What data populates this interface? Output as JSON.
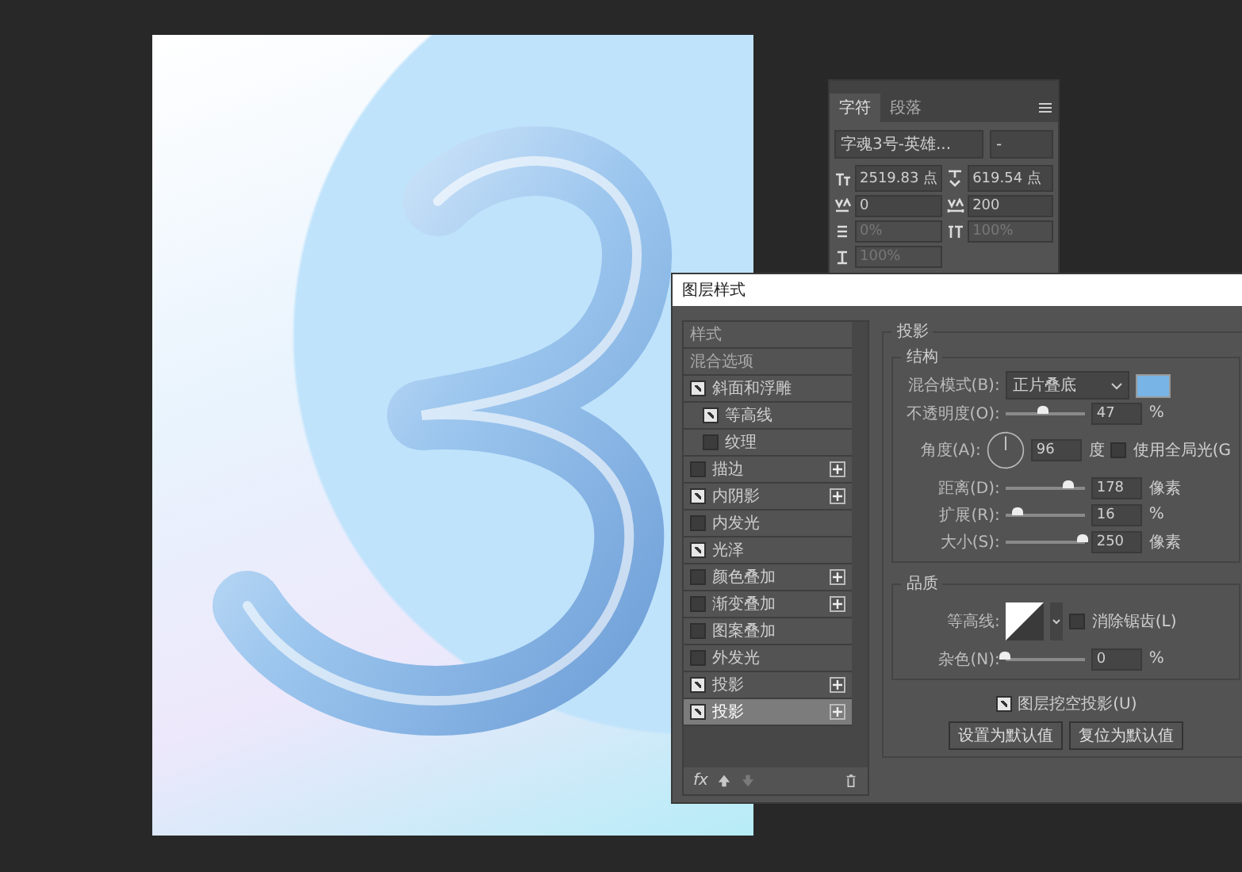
{
  "character_panel": {
    "tabs": [
      {
        "label": "字符",
        "selected": true
      },
      {
        "label": "段落",
        "selected": false
      }
    ],
    "font_family": "字魂3号-英雄...",
    "font_style": "-",
    "fields": [
      {
        "kind": "size",
        "value": "2519.83 点",
        "disabled": false
      },
      {
        "kind": "leading",
        "value": "619.54 点",
        "disabled": false
      },
      {
        "kind": "kerning",
        "value": "0",
        "disabled": false
      },
      {
        "kind": "tracking",
        "value": "200",
        "disabled": false
      },
      {
        "kind": "proportional",
        "value": "0%",
        "disabled": true
      },
      {
        "kind": "vertical_scale",
        "value": "100%",
        "disabled": true
      },
      {
        "kind": "horizontal_scale",
        "value": "100%",
        "disabled": true
      }
    ]
  },
  "layer_style": {
    "title": "图层样式",
    "styles_header": "样式",
    "blending_options": "混合选项",
    "effects": [
      {
        "label": "斜面和浮雕",
        "checked": true,
        "add_button": false,
        "selected": false,
        "children": [
          {
            "label": "等高线",
            "checked": true,
            "selected": false
          },
          {
            "label": "纹理",
            "checked": false,
            "selected": false
          }
        ]
      },
      {
        "label": "描边",
        "checked": false,
        "add_button": true,
        "selected": false
      },
      {
        "label": "内阴影",
        "checked": true,
        "add_button": true,
        "selected": false
      },
      {
        "label": "内发光",
        "checked": false,
        "add_button": false,
        "selected": false
      },
      {
        "label": "光泽",
        "checked": true,
        "add_button": false,
        "selected": false
      },
      {
        "label": "颜色叠加",
        "checked": false,
        "add_button": true,
        "selected": false
      },
      {
        "label": "渐变叠加",
        "checked": false,
        "add_button": true,
        "selected": false
      },
      {
        "label": "图案叠加",
        "checked": false,
        "add_button": false,
        "selected": false
      },
      {
        "label": "外发光",
        "checked": false,
        "add_button": false,
        "selected": false
      },
      {
        "label": "投影",
        "checked": true,
        "add_button": true,
        "selected": false
      },
      {
        "label": "投影",
        "checked": true,
        "add_button": true,
        "selected": true
      }
    ],
    "drop_shadow": {
      "title": "投影",
      "structure": {
        "title": "结构",
        "blend_mode_label": "混合模式(B):",
        "blend_mode": "正片叠底",
        "color": "#78b4e6",
        "rows": [
          {
            "kind": "slider",
            "label": "不透明度(O):",
            "level": 0.47,
            "value": "47",
            "unit": "%"
          },
          {
            "kind": "angle",
            "label": "角度(A):",
            "value": "96",
            "unit": "度",
            "checkbox_label": "使用全局光(G",
            "checked": false
          },
          {
            "kind": "slider",
            "label": "距离(D):",
            "level": 0.8,
            "value": "178",
            "unit": "像素"
          },
          {
            "kind": "slider",
            "label": "扩展(R):",
            "level": 0.16,
            "value": "16",
            "unit": "%"
          },
          {
            "kind": "slider",
            "label": "大小(S):",
            "level": 0.98,
            "value": "250",
            "unit": "像素"
          }
        ]
      },
      "quality": {
        "title": "品质",
        "contour_label": "等高线:",
        "anti_alias_label": "消除锯齿(L)",
        "anti_alias": false,
        "rows": [
          {
            "kind": "slider",
            "label": "杂色(N):",
            "level": 0,
            "value": "0",
            "unit": "%"
          }
        ]
      },
      "knockout_label": "图层挖空投影(U)",
      "knockout": true,
      "buttons": [
        "设置为默认值",
        "复位为默认值"
      ]
    },
    "footer_label": "fx"
  }
}
